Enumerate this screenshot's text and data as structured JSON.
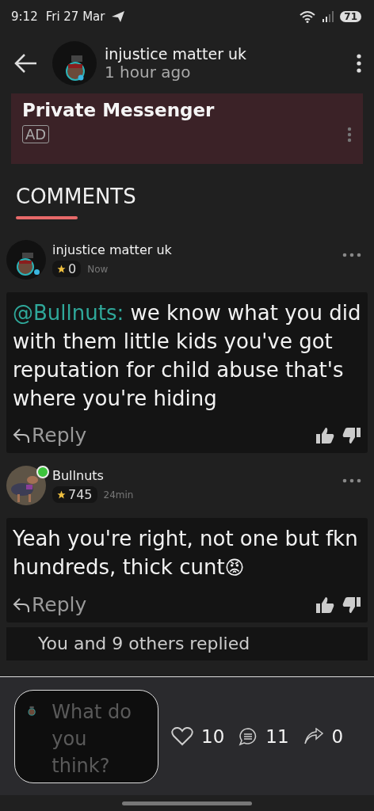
{
  "status_bar": {
    "time": "9:12",
    "date": "Fri 27 Mar",
    "battery": "71"
  },
  "header": {
    "author": "injustice matter uk",
    "posted": "1 hour ago"
  },
  "ad": {
    "title": "Private Messenger",
    "badge": "AD"
  },
  "comments_heading": "COMMENTS",
  "comments": [
    {
      "author": "injustice matter uk",
      "online": false,
      "points": "0",
      "time": "Now",
      "mention": "@Bullnuts:",
      "text": " we know what you did with them little kids you've got reputation for child abuse that's where you're hiding",
      "reply": "Reply"
    },
    {
      "author": "Bullnuts",
      "online": true,
      "points": "745",
      "time": "24min",
      "text": "Yeah you're right, not one but fkn hundreds, thick cunt",
      "emoji": "😡",
      "reply": "Reply"
    }
  ],
  "replies_summary": "You and 9 others replied",
  "composer": {
    "placeholder": "What do you think?"
  },
  "stats": {
    "likes": "10",
    "comments": "11",
    "shares": "0"
  }
}
